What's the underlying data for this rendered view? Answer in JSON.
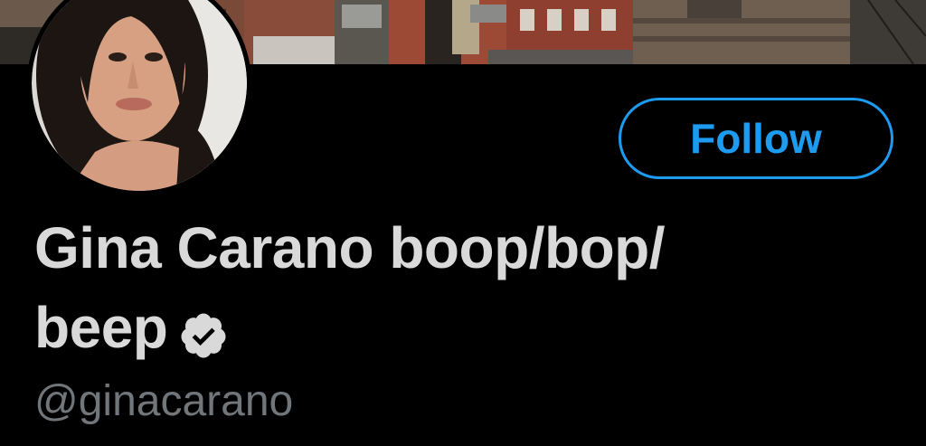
{
  "profile": {
    "banner_icon": "city-rooftops-photo",
    "avatar_icon": "profile-photo",
    "follow_label": "Follow",
    "display_name_line1": "Gina Carano boop/bop/",
    "display_name_line2": "beep",
    "verified_icon": "verified-badge-icon",
    "handle": "@ginacarano"
  },
  "colors": {
    "background": "#000000",
    "accent": "#1d9bf0",
    "name_text": "#d9d9d9",
    "handle_text": "#71767b"
  }
}
